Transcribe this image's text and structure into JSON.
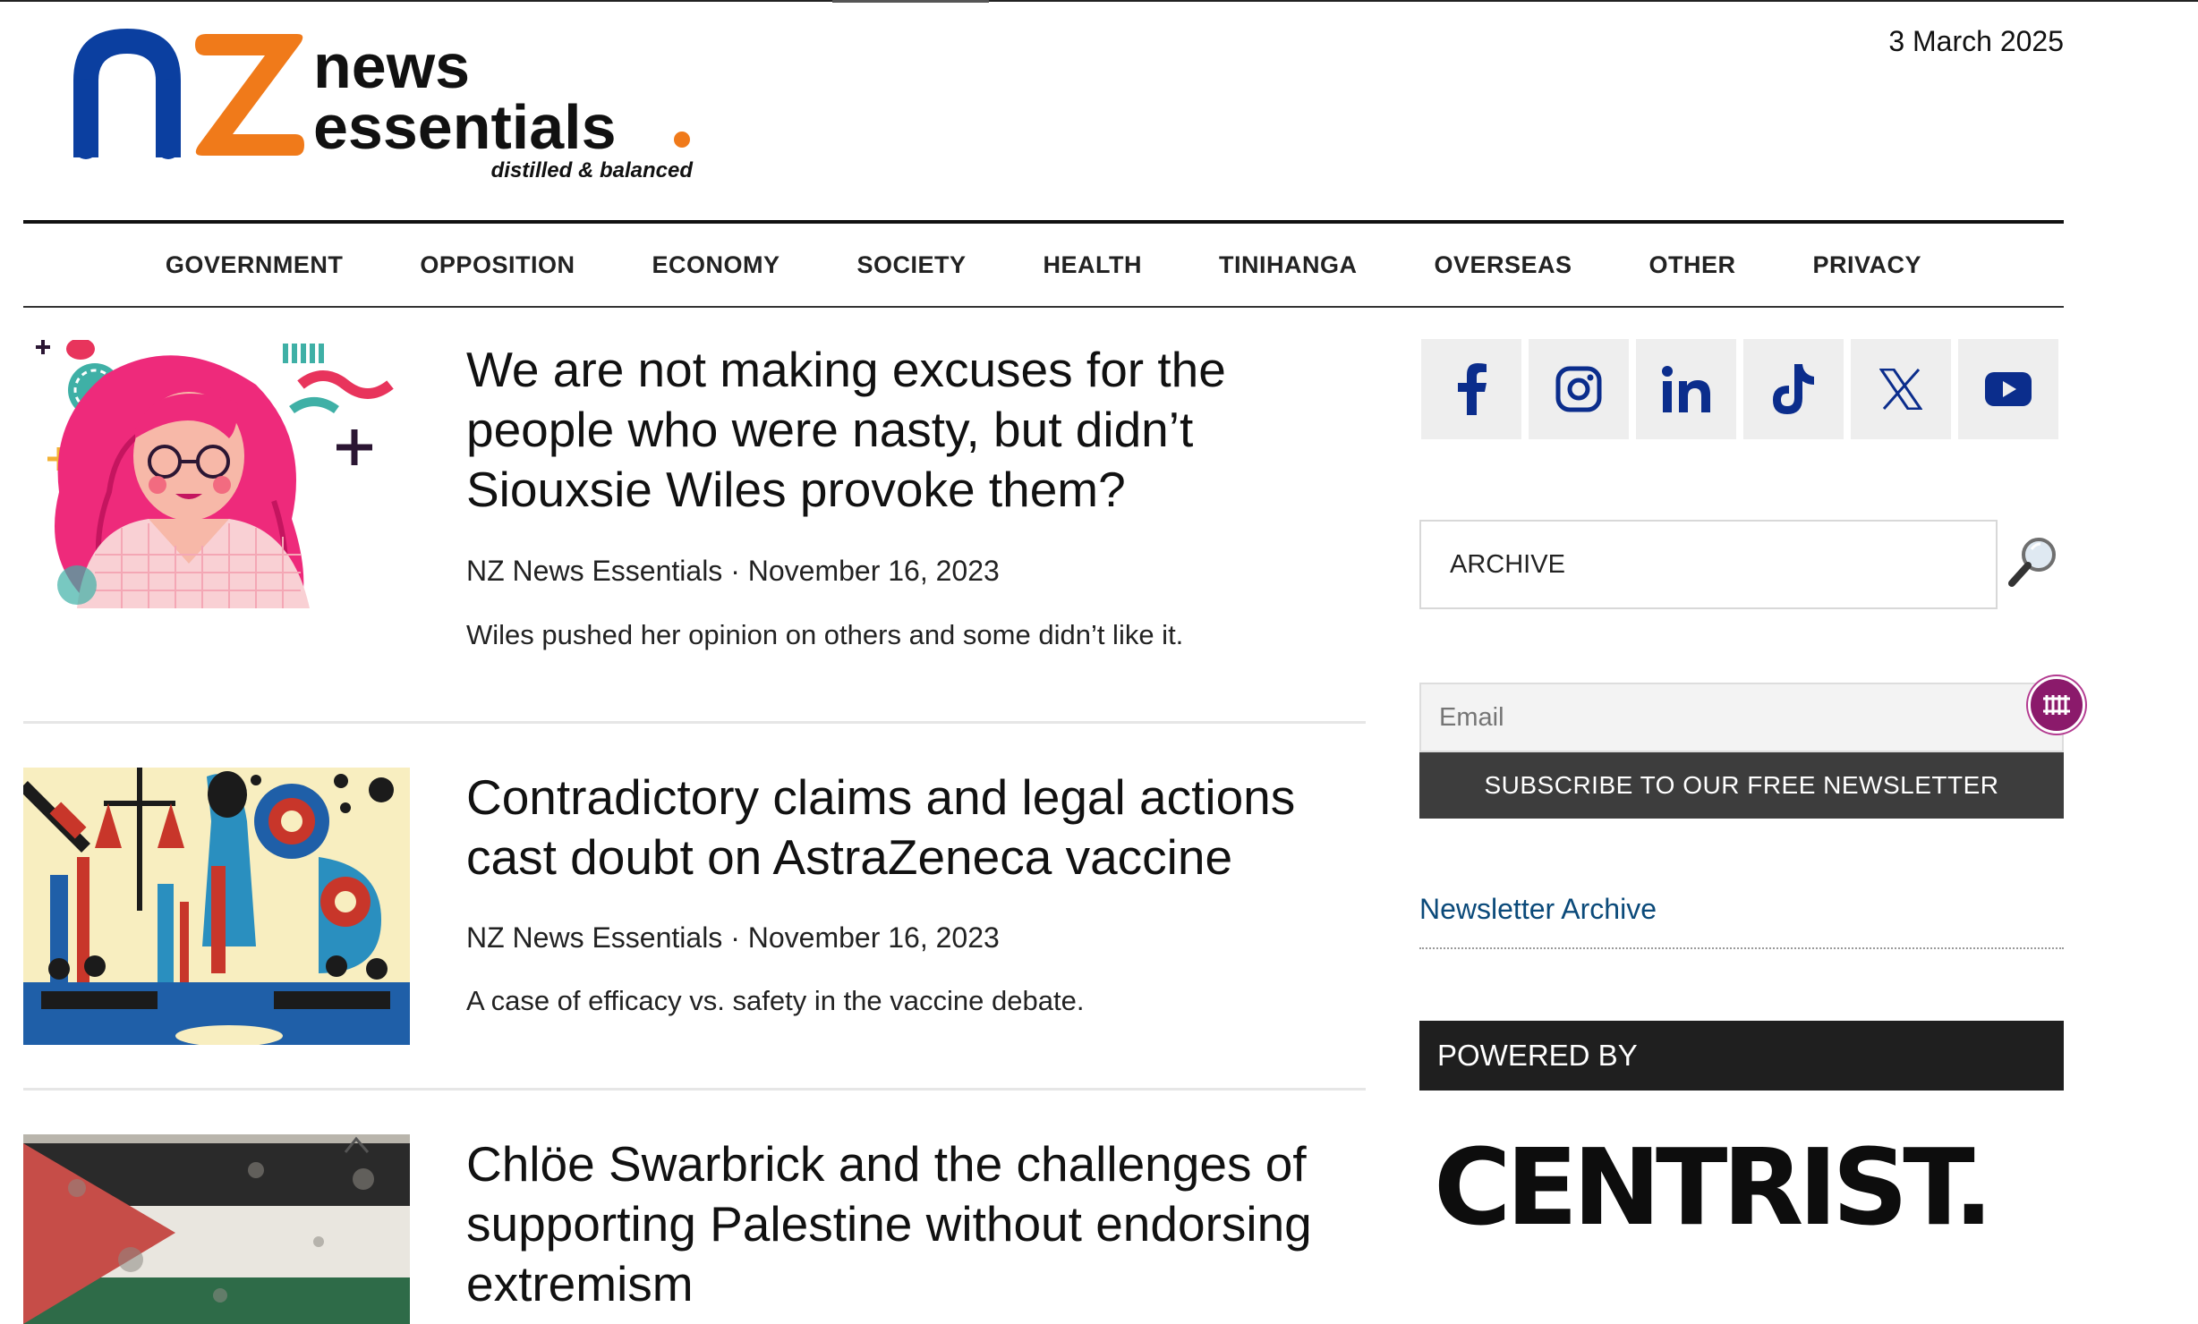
{
  "header": {
    "logo": {
      "mark": "nZ",
      "line1": "news",
      "line2": "essentials",
      "dot": ".",
      "tagline": "distilled & balanced",
      "colors": {
        "n": "#0b3fa0",
        "z": "#f07a1a",
        "text": "#111111",
        "dot": "#f07a1a"
      }
    },
    "date": "3 March 2025"
  },
  "nav": {
    "items": [
      "GOVERNMENT",
      "OPPOSITION",
      "ECONOMY",
      "SOCIETY",
      "HEALTH",
      "TINIHANGA",
      "OVERSEAS",
      "OTHER",
      "PRIVACY"
    ]
  },
  "articles": [
    {
      "title_lines": [
        "We are not making excuses for the",
        "people who were nasty, but didn’t",
        "Siouxsie Wiles provoke them?"
      ],
      "author": "NZ News Essentials",
      "separator": "·",
      "date": "November 16, 2023",
      "excerpt": "Wiles pushed her opinion on others and some didn’t like it.",
      "thumb": "illustration-woman-pink-hair"
    },
    {
      "title_lines": [
        "Contradictory claims and legal actions",
        "cast doubt on AstraZeneca vaccine"
      ],
      "author": "NZ News Essentials",
      "separator": "·",
      "date": "November 16, 2023",
      "excerpt": "A case of efficacy vs. safety in the vaccine debate.",
      "thumb": "illustration-vaccine-legal"
    },
    {
      "title_lines": [
        "Chlöe Swarbrick and the challenges of",
        "supporting Palestine without endorsing",
        "extremism"
      ],
      "thumb": "photo-palestine-flag"
    }
  ],
  "sidebar": {
    "social": [
      "facebook-icon",
      "instagram-icon",
      "linkedin-icon",
      "tiktok-icon",
      "x-icon",
      "youtube-icon"
    ],
    "social_color": "#0b2d8c",
    "search": {
      "value": "ARCHIVE"
    },
    "newsletter": {
      "email_placeholder": "Email",
      "subscribe_label": "SUBSCRIBE TO OUR FREE NEWSLETTER",
      "archive_link": "Newsletter Archive"
    },
    "powered_by": {
      "label": "POWERED BY",
      "brand": "CENTRIST."
    }
  }
}
